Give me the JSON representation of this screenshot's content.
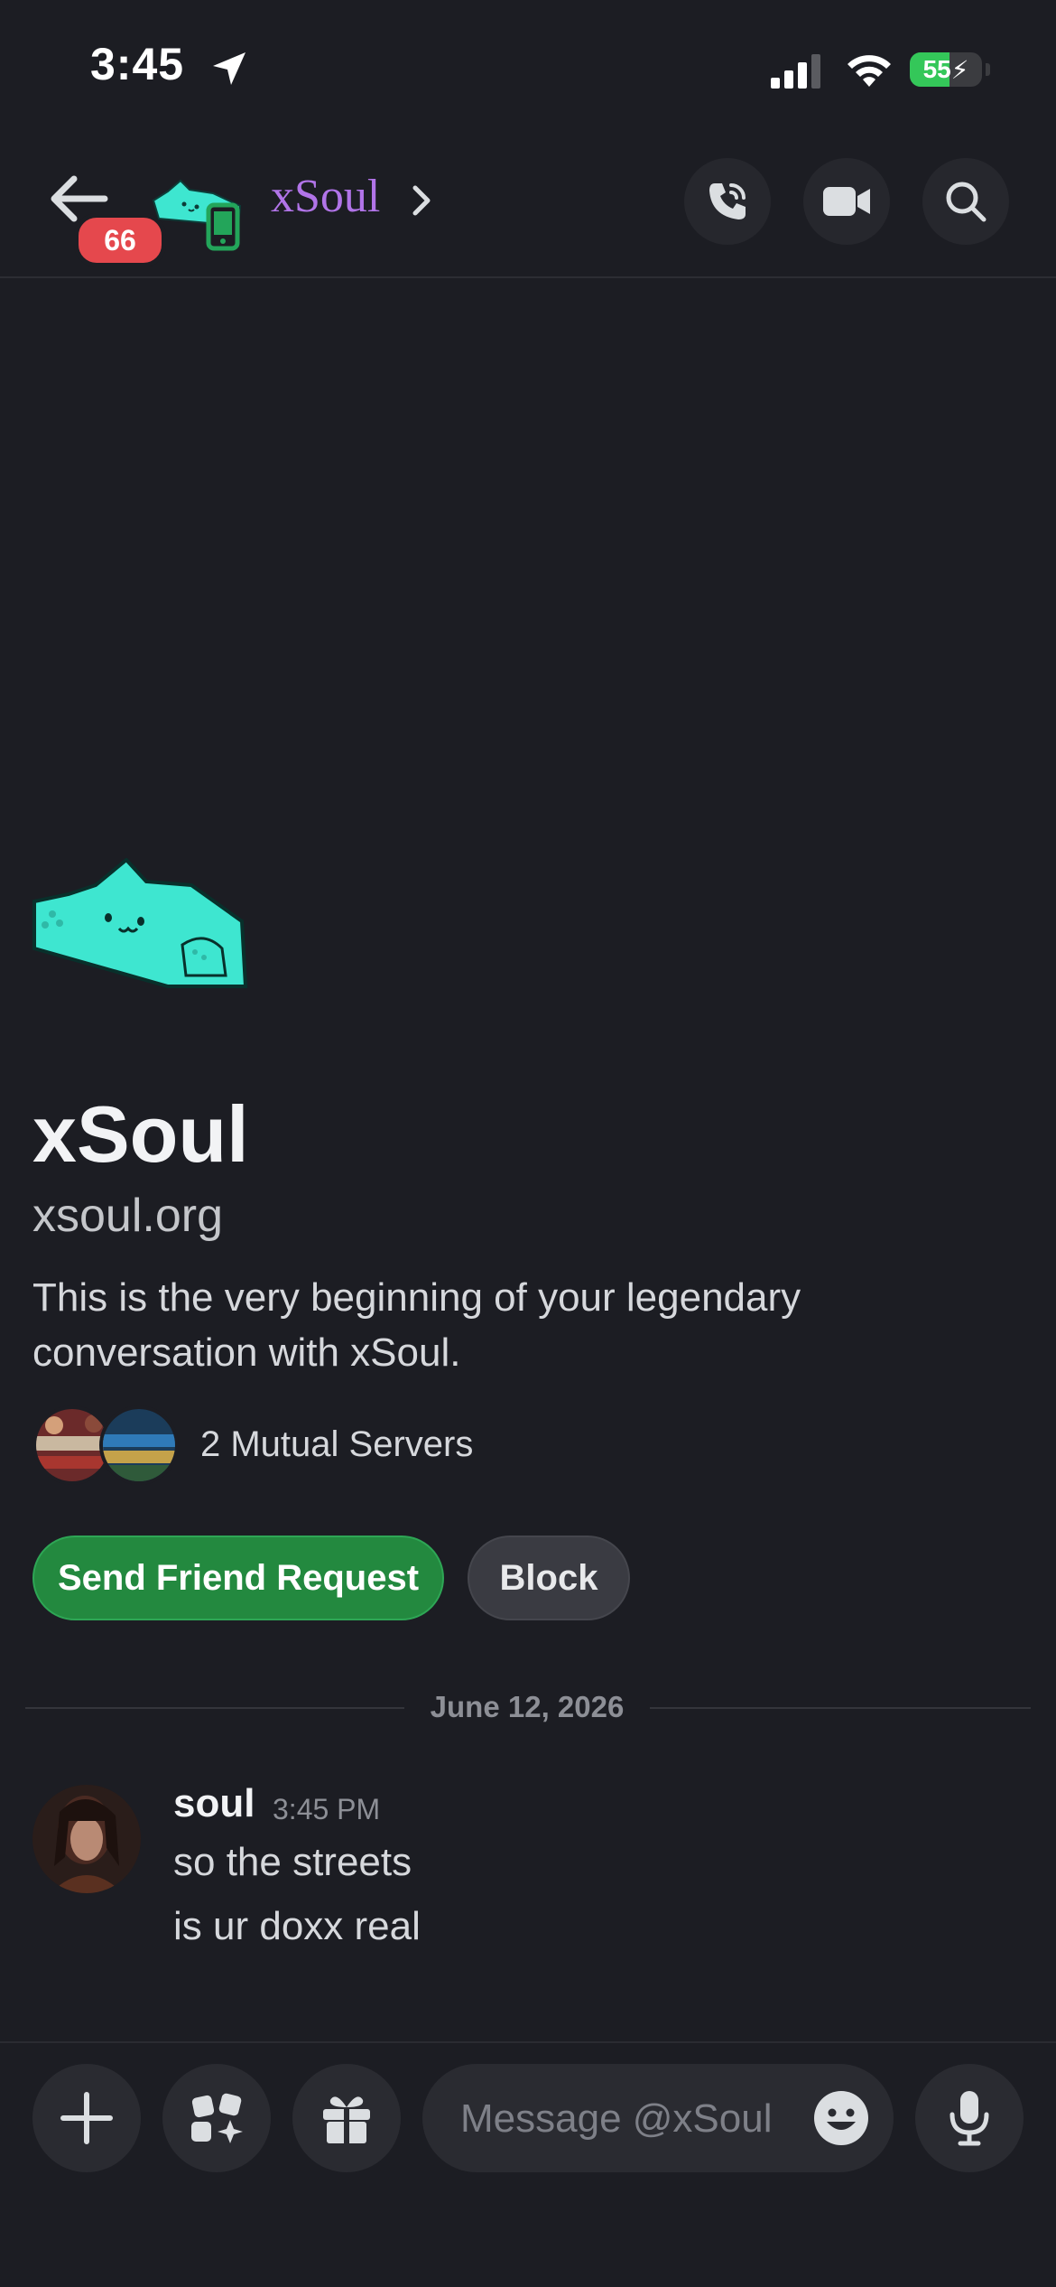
{
  "status_bar": {
    "time": "3:45",
    "battery": "55",
    "battery_level": 0.55
  },
  "header": {
    "unread_count": "66",
    "name": "xSoul"
  },
  "intro": {
    "display_name": "xSoul",
    "handle": "xsoul.org",
    "description": "This is the very beginning of your legendary conversation with xSoul.",
    "mutual_servers_label": "2 Mutual Servers",
    "send_friend_request_label": "Send Friend Request",
    "block_label": "Block"
  },
  "date_divider": "June 12, 2026",
  "messages": [
    {
      "author": "soul",
      "time": "3:45 PM",
      "lines": [
        "so the streets",
        "is ur doxx real"
      ]
    }
  ],
  "composer": {
    "placeholder": "Message @xSoul"
  },
  "colors": {
    "background": "#1c1d23",
    "username_purple": "#b174e8",
    "friend_button_green": "#23893f",
    "badge_red": "#e5484d",
    "avatar_cyan": "#3ee6d0"
  },
  "icons": {
    "location": "location-arrow-icon",
    "signal": "cellular-signal-icon",
    "wifi": "wifi-icon",
    "battery": "battery-charging-icon",
    "back": "back-arrow-icon",
    "mobile_status": "mobile-phone-icon",
    "chevron": "chevron-right-icon",
    "call": "phone-icon",
    "video": "video-camera-icon",
    "search": "search-icon",
    "plus": "plus-icon",
    "apps": "apps-icon",
    "gift": "gift-icon",
    "emoji": "emoji-icon",
    "mic": "microphone-icon"
  }
}
